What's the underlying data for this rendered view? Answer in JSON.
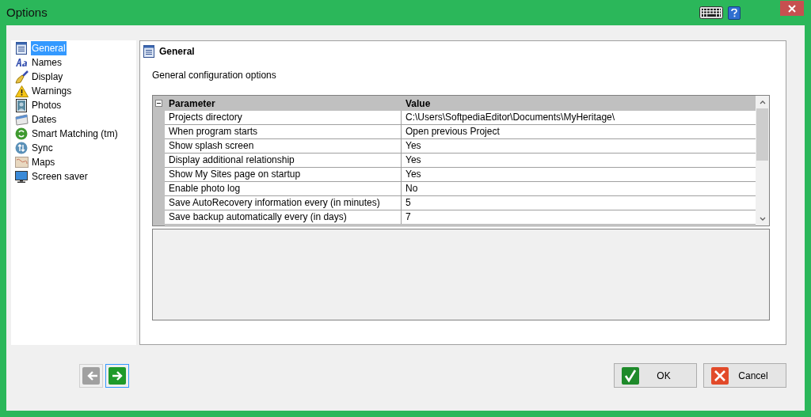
{
  "window": {
    "title": "Options"
  },
  "sidebar": {
    "items": [
      {
        "label": "General",
        "selected": true
      },
      {
        "label": "Names",
        "selected": false
      },
      {
        "label": "Display",
        "selected": false
      },
      {
        "label": "Warnings",
        "selected": false
      },
      {
        "label": "Photos",
        "selected": false
      },
      {
        "label": "Dates",
        "selected": false
      },
      {
        "label": "Smart Matching (tm)",
        "selected": false
      },
      {
        "label": "Sync",
        "selected": false
      },
      {
        "label": "Maps",
        "selected": false
      },
      {
        "label": "Screen saver",
        "selected": false
      }
    ]
  },
  "panel": {
    "title": "General",
    "description": "General configuration options",
    "table": {
      "columns": [
        "Parameter",
        "Value"
      ],
      "rows": [
        {
          "parameter": "Projects directory",
          "value": "C:\\Users\\SoftpediaEditor\\Documents\\MyHeritage\\"
        },
        {
          "parameter": "When program starts",
          "value": "Open previous Project"
        },
        {
          "parameter": "Show splash screen",
          "value": "Yes"
        },
        {
          "parameter": "Display additional relationship",
          "value": "Yes"
        },
        {
          "parameter": "Show My Sites page on startup",
          "value": "Yes"
        },
        {
          "parameter": "Enable photo log",
          "value": "No"
        },
        {
          "parameter": "Save AutoRecovery information every (in minutes)",
          "value": "5"
        },
        {
          "parameter": "Save backup automatically every (in days)",
          "value": "7"
        }
      ]
    }
  },
  "nav": {
    "back": {
      "disabled": true
    },
    "forward": {
      "disabled": false
    }
  },
  "buttons": [
    {
      "kind": "ok",
      "label": "OK"
    },
    {
      "kind": "cancel",
      "label": "Cancel"
    }
  ]
}
